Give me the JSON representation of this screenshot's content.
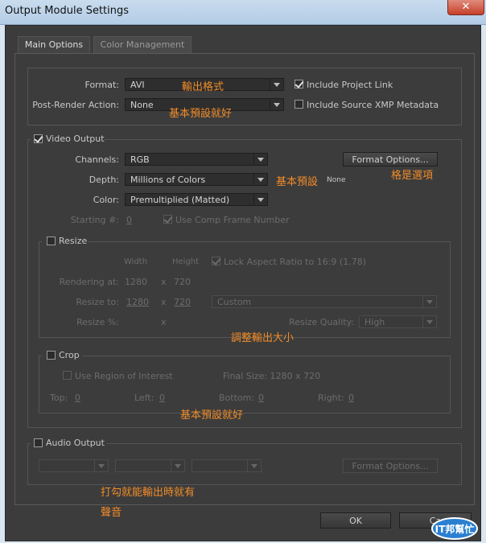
{
  "window": {
    "title": "Output Module Settings",
    "close": "✕"
  },
  "tabs": [
    {
      "label": "Main Options"
    },
    {
      "label": "Color Management"
    }
  ],
  "top": {
    "format_label": "Format:",
    "format_value": "AVI",
    "post_render_label": "Post-Render Action:",
    "post_render_value": "None",
    "include_project_link": "Include Project Link",
    "include_xmp": "Include Source XMP Metadata"
  },
  "video": {
    "title": "Video Output",
    "channels_label": "Channels:",
    "channels_value": "RGB",
    "depth_label": "Depth:",
    "depth_value": "Millions of Colors",
    "color_label": "Color:",
    "color_value": "Premultiplied (Matted)",
    "starting_label": "Starting #:",
    "starting_value": "0",
    "use_comp_frame": "Use Comp Frame Number",
    "format_options": "Format Options...",
    "none_text": "None"
  },
  "resize": {
    "title": "Resize",
    "width_hdr": "Width",
    "height_hdr": "Height",
    "lock_aspect": "Lock Aspect Ratio to 16:9 (1.78)",
    "rendering_label": "Rendering at:",
    "rendering_w": "1280",
    "rendering_h": "720",
    "resize_to_label": "Resize to:",
    "resize_to_w": "1280",
    "resize_to_h": "720",
    "x": "x",
    "preset_value": "Custom",
    "resize_pct_label": "Resize %:",
    "quality_label": "Resize Quality:",
    "quality_value": "High"
  },
  "crop": {
    "title": "Crop",
    "use_roi": "Use Region of Interest",
    "final_size": "Final Size: 1280 x 720",
    "top_label": "Top:",
    "top_value": "0",
    "left_label": "Left:",
    "left_value": "0",
    "bottom_label": "Bottom:",
    "bottom_value": "0",
    "right_label": "Right:",
    "right_value": "0"
  },
  "audio": {
    "title": "Audio Output",
    "format_options": "Format Options..."
  },
  "footer": {
    "ok": "OK",
    "cancel": "Ca"
  },
  "annotations": {
    "a1": "輸出格式",
    "a2": "基本預設就好",
    "a3": "基本預設",
    "a4": "格是選項",
    "a5": "調整輸出大小",
    "a6": "基本預設就好",
    "a7": "打勾就能輸出時就有",
    "a8": "聲音"
  },
  "watermark": {
    "text": "IT邦幫忙"
  },
  "colors": {
    "annotation": "#f28c28",
    "dialog_bg": "#3c3c3c"
  }
}
